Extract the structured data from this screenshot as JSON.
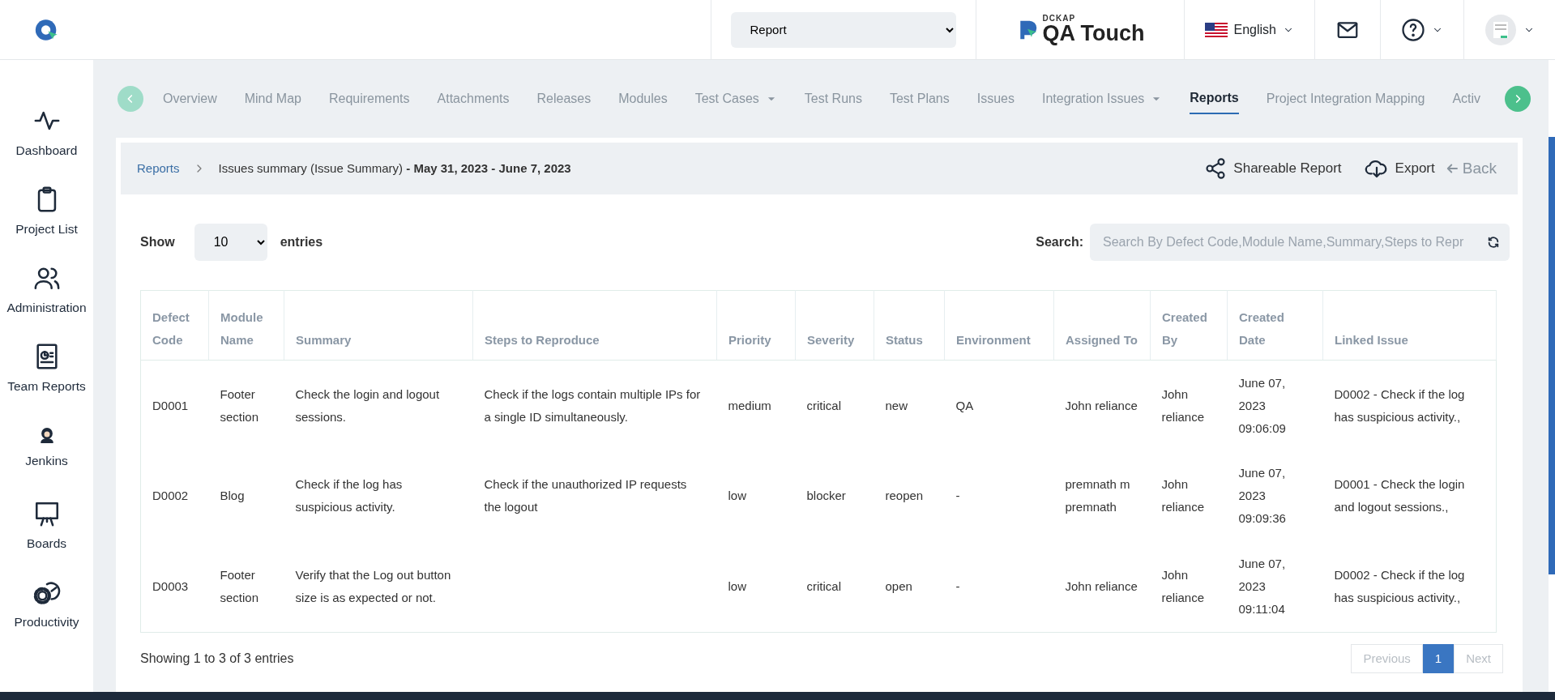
{
  "topbar": {
    "project_select": {
      "value": "Report"
    },
    "logo": {
      "brand_small": "DCKAP",
      "brand": "QA Touch"
    },
    "language": "English"
  },
  "sidebar": {
    "items": [
      {
        "label": "Dashboard",
        "kind": "pulse"
      },
      {
        "label": "Project List",
        "kind": "clipboard"
      },
      {
        "label": "Administration",
        "kind": "users"
      },
      {
        "label": "Team Reports",
        "kind": "report"
      },
      {
        "label": "Jenkins",
        "kind": "butler"
      },
      {
        "label": "Boards",
        "kind": "board"
      },
      {
        "label": "Productivity",
        "kind": "gear"
      }
    ]
  },
  "tabs": [
    {
      "label": "Overview",
      "selected": false,
      "dropdown": false
    },
    {
      "label": "Mind Map",
      "selected": false,
      "dropdown": false
    },
    {
      "label": "Requirements",
      "selected": false,
      "dropdown": false
    },
    {
      "label": "Attachments",
      "selected": false,
      "dropdown": false
    },
    {
      "label": "Releases",
      "selected": false,
      "dropdown": false
    },
    {
      "label": "Modules",
      "selected": false,
      "dropdown": false
    },
    {
      "label": "Test Cases",
      "selected": false,
      "dropdown": true
    },
    {
      "label": "Test Runs",
      "selected": false,
      "dropdown": false
    },
    {
      "label": "Test Plans",
      "selected": false,
      "dropdown": false
    },
    {
      "label": "Issues",
      "selected": false,
      "dropdown": false
    },
    {
      "label": "Integration Issues",
      "selected": false,
      "dropdown": true
    },
    {
      "label": "Reports",
      "selected": true,
      "dropdown": false
    },
    {
      "label": "Project Integration Mapping",
      "selected": false,
      "dropdown": false
    },
    {
      "label": "Activ",
      "selected": false,
      "dropdown": false
    }
  ],
  "breadcrumb": {
    "link": "Reports",
    "current": "Issues summary (Issue Summary) **- May 31, 2023 - June 7, 2023**"
  },
  "actions": {
    "share": "Shareable Report",
    "export": "Export",
    "back": "Back"
  },
  "length_menu": {
    "show": "Show",
    "value": "10",
    "entries": "entries"
  },
  "search": {
    "label": "Search:",
    "placeholder": "Search By Defect Code,Module Name,Summary,Steps to Repr"
  },
  "table": {
    "columns": [
      "Defect Code",
      "Module Name",
      "Summary",
      "Steps to Reproduce",
      "Priority",
      "Severity",
      "Status",
      "Environment",
      "Assigned To",
      "Created By",
      "Created Date",
      "Linked Issue"
    ],
    "rows": [
      [
        "D0001",
        "Footer section",
        "Check the login and logout sessions.",
        "Check if the logs contain multiple IPs for a single ID simultaneously.",
        "medium",
        "critical",
        "new",
        "QA",
        "John reliance",
        "John reliance",
        "June 07, 2023 09:06:09",
        "D0002 - Check if the log has suspicious activity.,"
      ],
      [
        "D0002",
        "Blog",
        "Check if the log has suspicious activity.",
        "Check if the unauthorized IP requests the logout",
        "low",
        "blocker",
        "reopen",
        "-",
        "premnath m premnath",
        "John reliance",
        "June 07, 2023 09:09:36",
        "D0001 - Check the login and logout sessions.,"
      ],
      [
        "D0003",
        "Footer section",
        "Verify that the Log out button size is as expected or not.",
        "",
        "low",
        "critical",
        "open",
        "-",
        "John reliance",
        "John reliance",
        "June 07, 2023 09:11:04",
        "D0002 - Check if the log has suspicious activity.,"
      ]
    ]
  },
  "info": "Showing 1 to 3 of 3 entries",
  "pagination": [
    {
      "label": "Previous",
      "selected": false
    },
    {
      "label": "1",
      "selected": true
    },
    {
      "label": "Next",
      "selected": false
    }
  ]
}
